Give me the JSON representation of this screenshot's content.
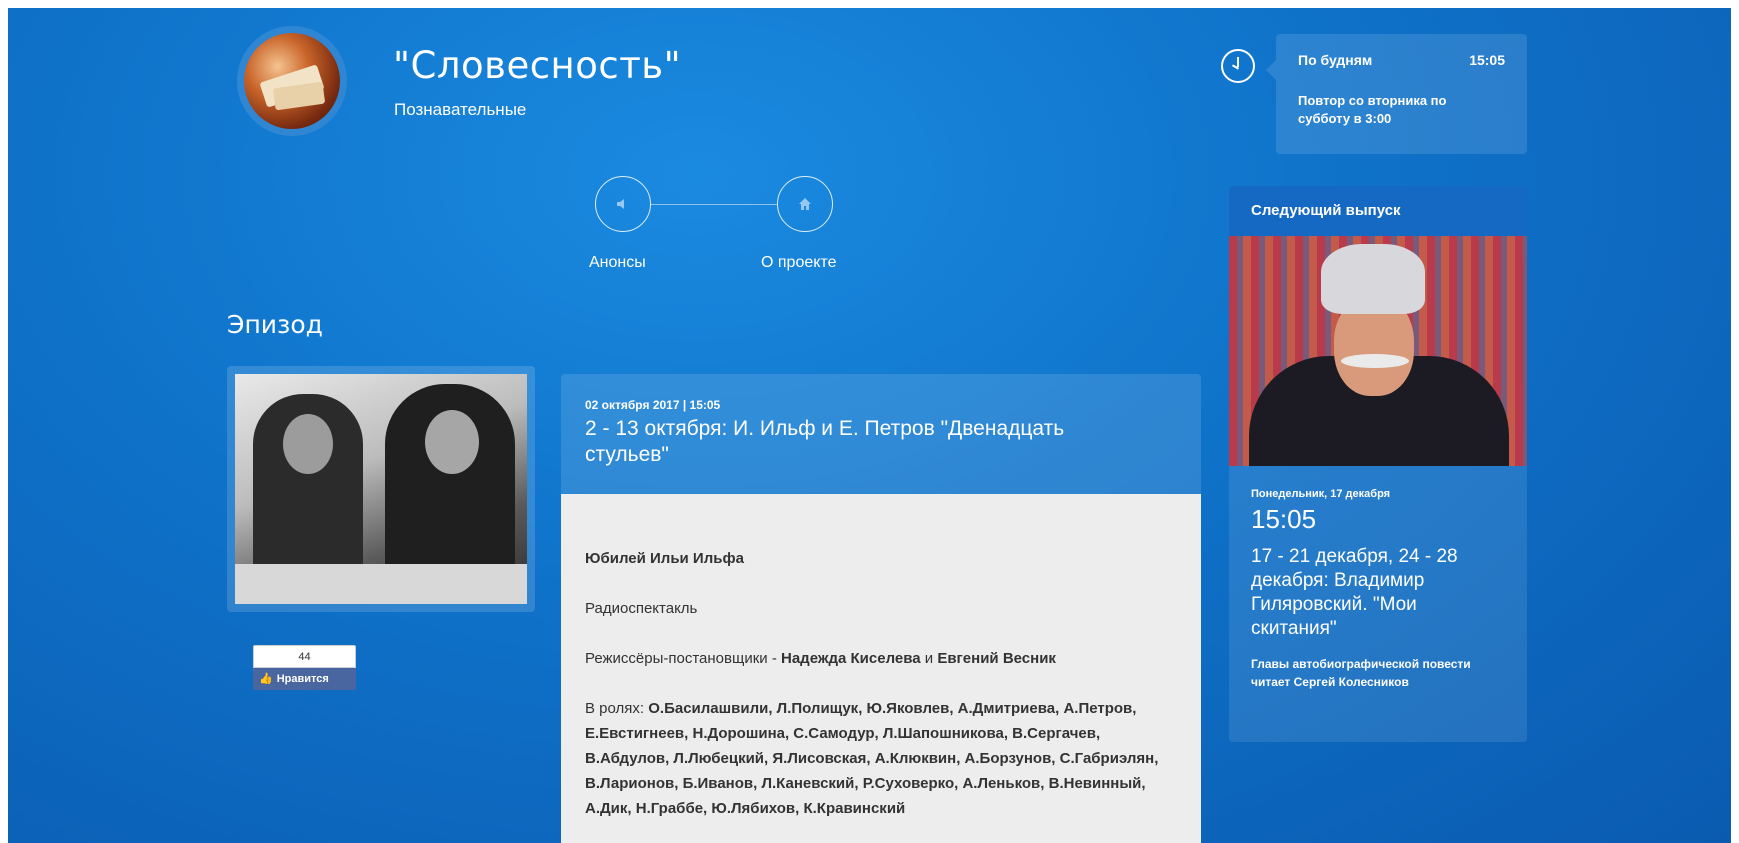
{
  "header": {
    "title": "\"Словесность\"",
    "subtitle": "Познавательные"
  },
  "schedule": {
    "days": "По будням",
    "time": "15:05",
    "repeat": "Повтор со вторника по субботу в 3:00"
  },
  "nav": {
    "items": [
      {
        "label": "Анонсы",
        "icon": "speaker-icon"
      },
      {
        "label": "О проекте",
        "icon": "home-icon"
      }
    ]
  },
  "section_title": "Эпизод",
  "episode": {
    "date": "02 октября 2017 | 15:05",
    "title": "2 - 13 октября: И. Ильф и Е. Петров \"Двенадцать стульев\"",
    "heading": "Юбилей Ильи Ильфа",
    "genre": "Радиоспектакль",
    "directors_label": "Режиссёры-постановщики - ",
    "director1": "Надежда Киселева",
    "and": " и ",
    "director2": "Евгений Весник",
    "cast_label": "В ролях: ",
    "cast": "О.Басилашвили, Л.Полищук, Ю.Яковлев, А.Дмитриева, А.Петров, Е.Евстигнеев, Н.Дорошина, С.Самодур, Л.Шапошникова, В.Сергачев, В.Абдулов, Л.Любецкий, Я.Лисовская, А.Клюквин, А.Борзунов, С.Габриэлян, В.Ларионов, Б.Иванов, Л.Каневский, Р.Суховерко, А.Леньков, В.Невинный, А.Дик, Н.Граббе, Ю.Лябихов, К.Кравинский"
  },
  "like": {
    "count": "44",
    "label": "Нравится"
  },
  "next": {
    "heading": "Следующий выпуск",
    "day": "Понедельник, 17 декабря",
    "time": "15:05",
    "title": "17 - 21 декабря, 24 - 28 декабря: Владимир Гиляровский. \"Мои скитания\"",
    "description": "Главы автобиографической повести читает Сергей Колесников"
  }
}
